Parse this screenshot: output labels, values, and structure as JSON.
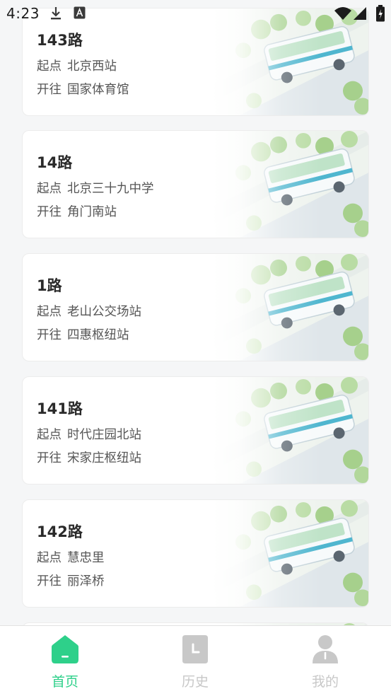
{
  "status_bar": {
    "time": "4:23"
  },
  "routes": [
    {
      "name": "143路",
      "origin_label": "起点",
      "origin": "北京西站",
      "dest_label": "开往",
      "dest": "国家体育馆"
    },
    {
      "name": "14路",
      "origin_label": "起点",
      "origin": "北京三十九中学",
      "dest_label": "开往",
      "dest": "角门南站"
    },
    {
      "name": "1路",
      "origin_label": "起点",
      "origin": "老山公交场站",
      "dest_label": "开往",
      "dest": "四惠枢纽站"
    },
    {
      "name": "141路",
      "origin_label": "起点",
      "origin": "时代庄园北站",
      "dest_label": "开往",
      "dest": "宋家庄枢纽站"
    },
    {
      "name": "142路",
      "origin_label": "起点",
      "origin": "慧忠里",
      "dest_label": "开往",
      "dest": "丽泽桥"
    }
  ],
  "bottom_nav": {
    "items": [
      {
        "label": "首页",
        "icon": "home-icon",
        "active": true
      },
      {
        "label": "历史",
        "icon": "history-icon",
        "active": false
      },
      {
        "label": "我的",
        "icon": "profile-icon",
        "active": false
      }
    ]
  },
  "colors": {
    "accent": "#2ed08a",
    "inactive": "#c8c8c8",
    "background": "#f5f6f7"
  }
}
